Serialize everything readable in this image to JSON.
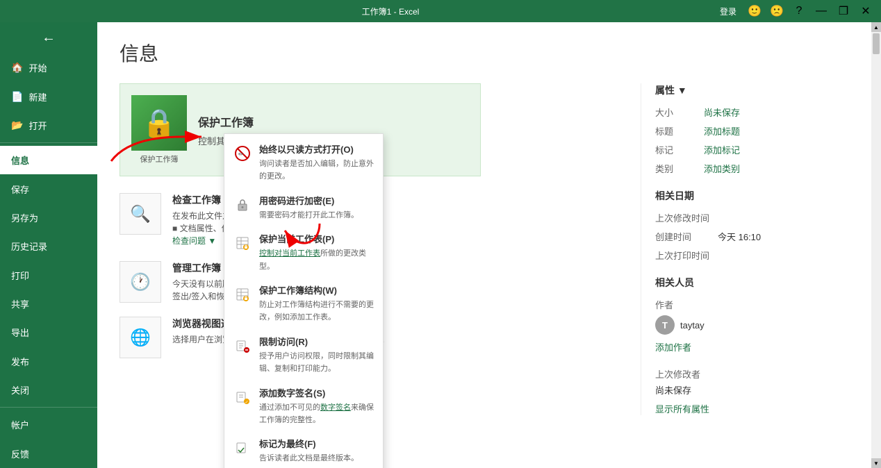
{
  "titlebar": {
    "title": "工作簿1 - Excel",
    "login_label": "登录",
    "help_label": "?",
    "minimize_label": "—",
    "restore_label": "❐",
    "close_label": "✕",
    "smiley_label": "🙂",
    "sad_label": "🙁"
  },
  "sidebar": {
    "back_label": "←",
    "items": [
      {
        "id": "home",
        "label": "开始",
        "icon": "🏠"
      },
      {
        "id": "new",
        "label": "新建",
        "icon": "📄"
      },
      {
        "id": "open",
        "label": "打开",
        "icon": "📂"
      },
      {
        "id": "info",
        "label": "信息",
        "active": true
      },
      {
        "id": "save",
        "label": "保存"
      },
      {
        "id": "saveas",
        "label": "另存为"
      },
      {
        "id": "history",
        "label": "历史记录"
      },
      {
        "id": "print",
        "label": "打印"
      },
      {
        "id": "share",
        "label": "共享"
      },
      {
        "id": "export",
        "label": "导出"
      },
      {
        "id": "publish",
        "label": "发布"
      },
      {
        "id": "close",
        "label": "关闭"
      },
      {
        "id": "account",
        "label": "帐户"
      },
      {
        "id": "feedback",
        "label": "反馈"
      }
    ]
  },
  "page": {
    "title": "信息"
  },
  "protect_card": {
    "icon": "🔒",
    "icon_label": "保护工作簿",
    "title": "保护工作簿",
    "description": "控制其他人可以对此工作簿所做的更改类型。"
  },
  "dropdown_menu": {
    "items": [
      {
        "id": "readonly",
        "icon": "✏️",
        "icon_style": "strikethrough",
        "title": "始终以只读方式打开(O)",
        "desc": "询问读者是否加入编辑，防止意外的更改。"
      },
      {
        "id": "encrypt",
        "icon": "🔑",
        "title": "用密码进行加密(E)",
        "desc": "需要密码才能打开此工作簿。"
      },
      {
        "id": "protect-sheet",
        "icon": "📋",
        "title": "保护当前工作表(P)",
        "desc": "控制对当前工作表所做的更改类型。"
      },
      {
        "id": "protect-structure",
        "icon": "📊",
        "title": "保护工作簿结构(W)",
        "desc": "防止对工作簿结构进行不需要的更改，例如添加工作表。"
      },
      {
        "id": "restrict",
        "icon": "🚫",
        "title": "限制访问(R)",
        "desc": "授予用户访问权限，同时限制其编辑、复制和打印能力。"
      },
      {
        "id": "signature",
        "icon": "✍️",
        "title": "添加数字签名(S)",
        "desc": "通过添加不可见的数字签名来确保工作簿的完整性。"
      },
      {
        "id": "final",
        "icon": "✅",
        "title": "标记为最终(F)",
        "desc": "告诉读者此文档是最终版本。"
      }
    ]
  },
  "inspect_section": {
    "icon": "🔍",
    "title": "检查工作簿",
    "desc1": "在发布此文件之前，请注意其是否包含：",
    "desc2": "■ 文档属性、作者姓名和绝对路径",
    "desc3_label": "检查问题"
  },
  "versions_section": {
    "icon": "🕐",
    "title": "管理工作簿",
    "desc": "今天没有以前版本的工作簿。\n签出/签入和恢复未保存的更改。"
  },
  "browser_section": {
    "icon": "🌐",
    "title": "浏览器视图选项",
    "desc": "选择用户在浏览器中查看此工作簿时用户可以看到的内容。"
  },
  "properties": {
    "section_title": "属性 ▼",
    "rows": [
      {
        "label": "大小",
        "value": "尚未保存",
        "is_link": true
      },
      {
        "label": "标题",
        "value": "添加标题",
        "is_link": true
      },
      {
        "label": "标记",
        "value": "添加标记",
        "is_link": true
      },
      {
        "label": "类别",
        "value": "添加类别",
        "is_link": true
      }
    ],
    "dates_title": "相关日期",
    "dates": [
      {
        "label": "上次修改时间",
        "value": ""
      },
      {
        "label": "创建时间",
        "value": "今天 16:10"
      },
      {
        "label": "上次打印时间",
        "value": ""
      }
    ],
    "people_title": "相关人员",
    "author_label": "作者",
    "author_initial": "T",
    "author_name": "taytay",
    "add_author": "添加作者",
    "last_modified_label": "上次修改者",
    "last_modified_value": "尚未保存",
    "show_all": "显示所有属性"
  }
}
